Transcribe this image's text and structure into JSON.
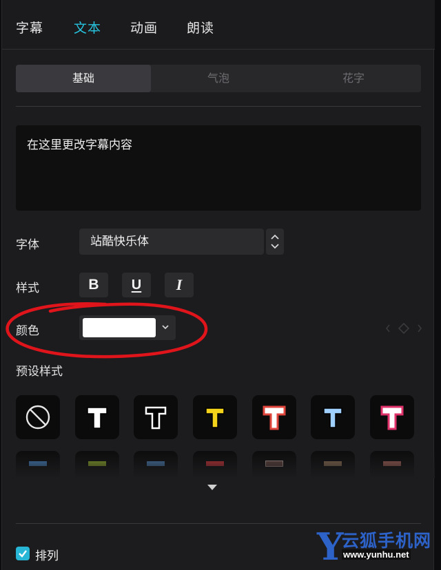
{
  "top_tabs": [
    {
      "label": "字幕",
      "active": false
    },
    {
      "label": "文本",
      "active": true
    },
    {
      "label": "动画",
      "active": false
    },
    {
      "label": "朗读",
      "active": false
    }
  ],
  "sub_tabs": [
    {
      "label": "基础",
      "active": true
    },
    {
      "label": "气泡",
      "active": false
    },
    {
      "label": "花字",
      "active": false
    }
  ],
  "text_input": {
    "value": "在这里更改字幕内容"
  },
  "font": {
    "label": "字体",
    "value": "站酷快乐体"
  },
  "style": {
    "label": "样式",
    "bold": "B",
    "underline": "U",
    "italic": "I"
  },
  "color": {
    "label": "颜色",
    "value": "#ffffff"
  },
  "presets": {
    "label": "预设样式",
    "row1": [
      {
        "icon": "none-icon"
      },
      {
        "glyph": "T",
        "fill": "#ffffff",
        "stroke": "#000000"
      },
      {
        "glyph": "T",
        "fill": "#000000",
        "stroke": "#ffffff"
      },
      {
        "glyph": "T",
        "fill": "#f5d31a",
        "stroke": "#000000"
      },
      {
        "glyph": "T",
        "fill": "#ffffff",
        "stroke": "#e0463b"
      },
      {
        "glyph": "T",
        "fill": "#9fd0ff",
        "stroke": "#000000"
      },
      {
        "glyph": "T",
        "fill": "#ffffff",
        "stroke": "#e0336b"
      }
    ],
    "row2_colors": [
      "#4a8fd6",
      "#9bbb2a",
      "#4f86c0",
      "#e0353b",
      "#6b4a44",
      "#9c7a5a",
      "#b56a5e"
    ]
  },
  "arrange": {
    "label": "排列",
    "checked": true
  },
  "colors": {
    "accent": "#27c3de",
    "annotation": "#e0141b",
    "panel": "#1c1c1e"
  },
  "watermark": {
    "letter": "Y",
    "title": "云狐手机网",
    "url": "www.yunhu.net"
  }
}
